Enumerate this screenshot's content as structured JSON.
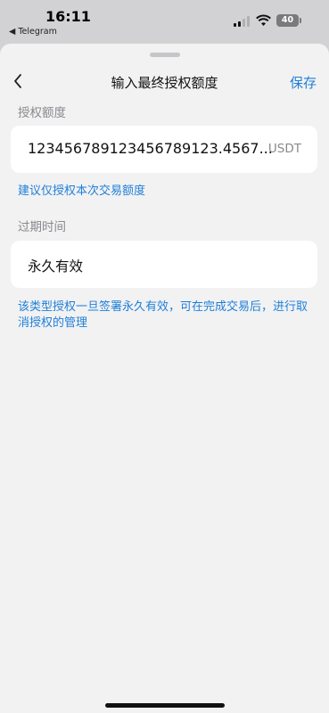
{
  "status_bar": {
    "time": "16:11",
    "back_app": "◀ Telegram",
    "battery": "40"
  },
  "nav": {
    "title": "输入最终授权额度",
    "save_label": "保存"
  },
  "amount": {
    "section_label": "授权额度",
    "value": "12345678912345678912​3.4567...",
    "unit": "USDT",
    "suggest_link": "建议仅授权本次交易额度"
  },
  "expiry": {
    "section_label": "过期时间",
    "value": "永久有效",
    "note": "该类型授权一旦签署永久有效，可在完成交易后，进行取消授权的管理"
  },
  "colors": {
    "accent": "#1f7fd8",
    "background": "#f2f2f3",
    "card": "#ffffff"
  }
}
